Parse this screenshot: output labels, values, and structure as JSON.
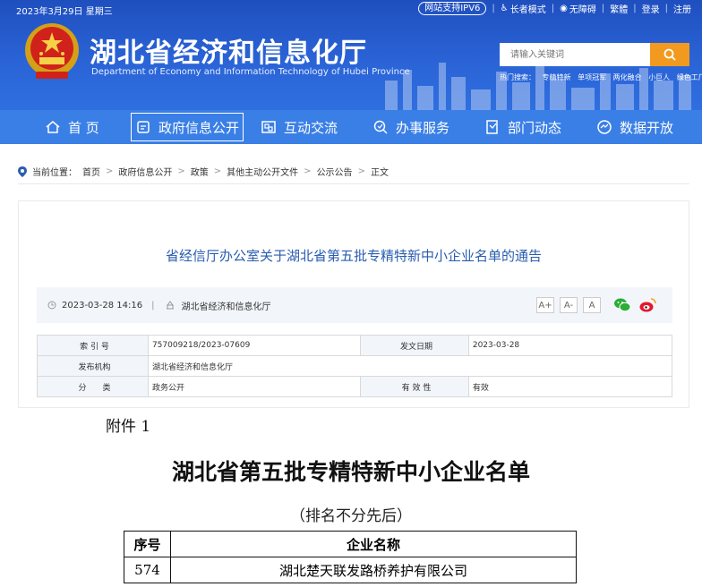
{
  "topbar": {
    "date": "2023年3月29日 星期三",
    "ipv6": "网站支持IPV6",
    "links": [
      "长者模式",
      "无障碍",
      "繁體",
      "登录",
      "注册"
    ]
  },
  "header": {
    "title_cn": "湖北省经济和信息化厅",
    "title_en": "Department of Economy and Information Technology of Hubei Province",
    "search_placeholder": "请输入关键词",
    "hot_label": "热门搜索：",
    "hot_terms": [
      "专精特新",
      "单项冠军",
      "两化融合",
      "小巨人",
      "绿色工厂"
    ]
  },
  "nav": {
    "items": [
      {
        "label": "首 页",
        "icon": "home-icon"
      },
      {
        "label": "政府信息公开",
        "icon": "document-icon"
      },
      {
        "label": "互动交流",
        "icon": "chat-icon"
      },
      {
        "label": "办事服务",
        "icon": "search-service-icon"
      },
      {
        "label": "部门动态",
        "icon": "news-icon"
      },
      {
        "label": "数据开放",
        "icon": "data-icon"
      }
    ]
  },
  "breadcrumb": {
    "prefix": "当前位置：",
    "items": [
      "首页",
      "政府信息公开",
      "政策",
      "其他主动公开文件",
      "公示公告",
      "正文"
    ]
  },
  "article": {
    "title": "省经信厅办公室关于湖北省第五批专精特新中小企业名单的通告",
    "date": "2023-03-28 14:16",
    "source": "湖北省经济和信息化厅",
    "font_sizes": [
      "A+",
      "A-",
      "A"
    ],
    "info": {
      "index_label": "索 引 号",
      "index_value": "757009218/2023-07609",
      "pubdate_label": "发文日期",
      "pubdate_value": "2023-03-28",
      "org_label": "发布机构",
      "org_value": "湖北省经济和信息化厅",
      "cat_label": "分　　类",
      "cat_value": "政务公开",
      "valid_label": "有 效 性",
      "valid_value": "有效"
    }
  },
  "attachment": {
    "label": "附件 1",
    "title": "湖北省第五批专精特新中小企业名单",
    "subtitle": "（排名不分先后）",
    "col_no": "序号",
    "col_name": "企业名称",
    "rows": [
      {
        "no": "574",
        "name": "湖北楚天联发路桥养护有限公司"
      }
    ]
  },
  "colors": {
    "header_blue": "#2a63d6",
    "nav_blue": "#3a7fe6",
    "search_orange": "#f29a1f",
    "title_blue": "#2a5db0"
  }
}
